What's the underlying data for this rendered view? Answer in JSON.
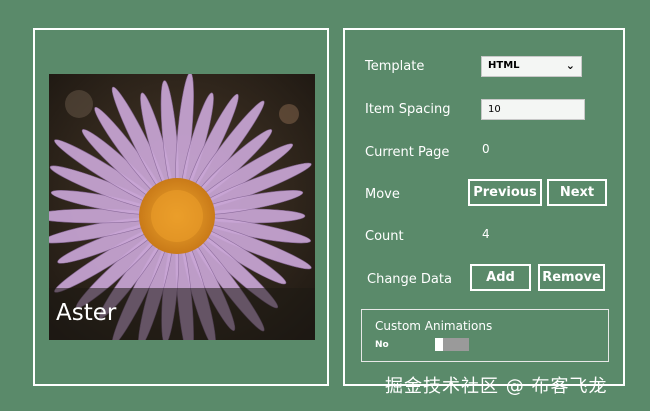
{
  "flipview": {
    "caption": "Aster"
  },
  "controls": {
    "template_label": "Template",
    "template_value": "HTML",
    "item_spacing_label": "Item Spacing",
    "item_spacing_value": "10",
    "current_page_label": "Current Page",
    "current_page_value": "0",
    "move_label": "Move",
    "previous_label": "Previous",
    "next_label": "Next",
    "count_label": "Count",
    "count_value": "4",
    "change_data_label": "Change Data",
    "add_label": "Add",
    "remove_label": "Remove"
  },
  "animations": {
    "title": "Custom Animations",
    "toggle_state": "No",
    "toggle_on": false
  },
  "watermark": "掘金技术社区 @ 布客飞龙",
  "colors": {
    "background": "#5a8a6a",
    "petal": "#c9a6d6",
    "center": "#e0962a"
  }
}
